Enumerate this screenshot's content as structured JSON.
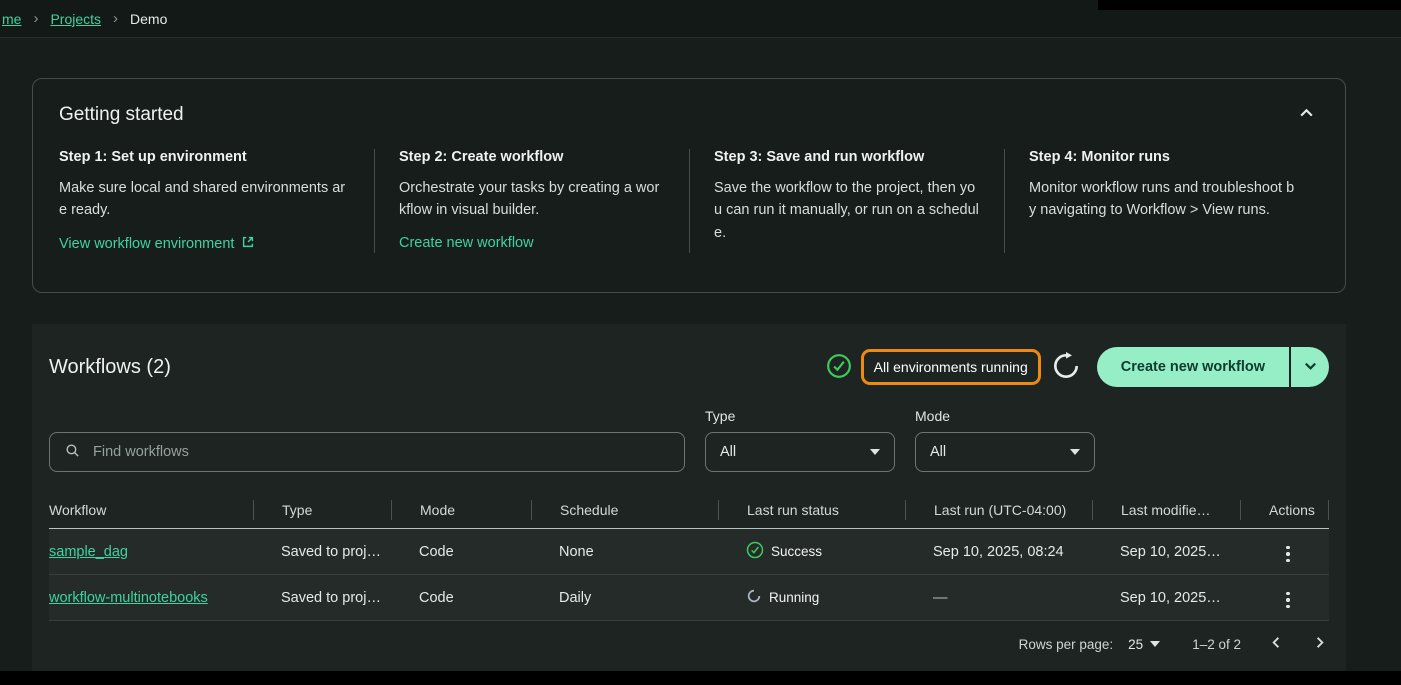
{
  "breadcrumb": {
    "items": [
      {
        "label": "me"
      },
      {
        "label": "Projects"
      },
      {
        "label": "Demo"
      }
    ],
    "separator": "›"
  },
  "getting_started": {
    "title": "Getting started",
    "steps": [
      {
        "title": "Step 1: Set up environment",
        "body": "Make sure local and shared environments are ready.",
        "link": "View workflow environment"
      },
      {
        "title": "Step 2: Create workflow",
        "body": "Orchestrate your tasks by creating a workflow in visual builder.",
        "link": "Create new workflow"
      },
      {
        "title": "Step 3: Save and run workflow",
        "body": "Save the workflow to the project, then you can run it manually, or run on a schedule."
      },
      {
        "title": "Step 4: Monitor runs",
        "body": "Monitor workflow runs and troubleshoot by navigating to Workflow > View runs."
      }
    ]
  },
  "workflows": {
    "heading": "Workflows (2)",
    "environment_status": "All environments running",
    "create_button_label": "Create new workflow",
    "filters": {
      "search_placeholder": "Find workflows",
      "type_label": "Type",
      "type_value": "All",
      "mode_label": "Mode",
      "mode_value": "All"
    },
    "table": {
      "columns": [
        "Workflow",
        "Type",
        "Mode",
        "Schedule",
        "Last run status",
        "Last run (UTC-04:00)",
        "Last modifie…",
        "Actions"
      ],
      "rows": [
        {
          "workflow": "sample_dag",
          "type": "Saved to proj…",
          "mode": "Code",
          "schedule": "None",
          "status": "Success",
          "last_run": "Sep 10, 2025, 08:24",
          "last_modified": "Sep 10, 2025…"
        },
        {
          "workflow": "workflow-multinotebooks",
          "type": "Saved to proj…",
          "mode": "Code",
          "schedule": "Daily",
          "status": "Running",
          "last_run": "—",
          "last_modified": "Sep 10, 2025…"
        }
      ]
    },
    "pagination": {
      "rows_per_page_label": "Rows per page:",
      "rows_per_page_value": "25",
      "range": "1–2 of 2"
    }
  },
  "colors": {
    "accent_link": "#3fd3a0",
    "button_bg": "#96eec6",
    "highlight_orange": "#ec8a12",
    "success_green": "#3ecb5e"
  }
}
